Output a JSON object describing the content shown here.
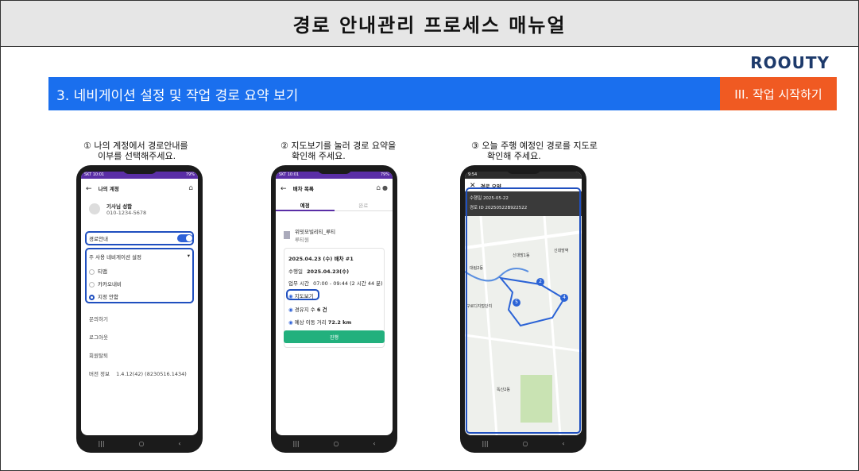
{
  "header": {
    "title": "경로 안내관리 프로세스 매뉴얼",
    "brand": "ROOUTY"
  },
  "section": {
    "title": "3. 네비게이션 설정 및 작업 경로 요약 보기",
    "tag": "III. 작업 시작하기"
  },
  "steps": [
    {
      "caption_line1": "① 나의 계정에서 경로안내를",
      "caption_line2": "이부를 선택해주세요."
    },
    {
      "caption_line1": "② 지도보기를 눌러 경로 요약을",
      "caption_line2": "확인해 주세요."
    },
    {
      "caption_line1": "③ 오늘 주행 예정인 경로를 지도로",
      "caption_line2": "확인해 주세요."
    }
  ],
  "phone1": {
    "status_time": "SKT 10:01",
    "status_right": "79%",
    "title": "나의 계정",
    "user_name": "기사님 성함",
    "user_phone": "010-1234-5678",
    "route_guide_label": "경로안내",
    "nav_setting_label": "주 사용 네비게이션 설정",
    "options": [
      "티맵",
      "카카오내비",
      "지정 안함"
    ],
    "menu": [
      "문의하기",
      "로그아웃",
      "회원탈퇴"
    ],
    "version_label": "버전 정보",
    "version_value": "1.4.12(42) (8230516.1434)"
  },
  "phone2": {
    "status_time": "SKT 10:01",
    "status_right": "79%",
    "title": "배차 목록",
    "tab_active": "예정",
    "tab_inactive": "완료",
    "company": "위밋모빌리티_루티",
    "company_sub": "루티원",
    "dispatch": "2025.04.23 (수) 배차 #1",
    "drive_date_label": "수행일",
    "drive_date": "2025.04.23(수)",
    "work_time_label": "업무 시간",
    "work_time": "07:00 - 09:44 (2 시간 44 분)",
    "map_view": "지도보기",
    "waypoint_label": "경유지 수",
    "waypoint_value": "6 건",
    "distance_label": "예상 이동 거리",
    "distance_value": "72.2 km",
    "button": "진행"
  },
  "phone3": {
    "status_time": "9:54",
    "title": "경로 요약",
    "drive_date_label": "수행일",
    "drive_date": "2025-05-22",
    "dispatch_id_label": "경로 ID",
    "dispatch_id": "20250522B922522",
    "markers": [
      "2",
      "4",
      "5"
    ],
    "map_labels": [
      "신대방1동",
      "대림2동",
      "신대방역",
      "구로디지털단지",
      "독산2동"
    ]
  },
  "colors": {
    "primary": "#1a6fee",
    "accent": "#f05a22",
    "highlight": "#1f4fbf",
    "green": "#22b07d"
  }
}
